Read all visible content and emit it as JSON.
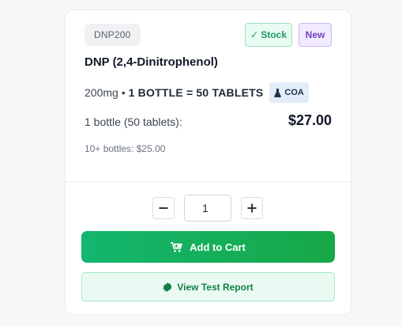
{
  "product": {
    "sku": "DNP200",
    "stock_badge": "✓ Stock",
    "new_badge": "New",
    "title": "DNP (2,4-Dinitrophenol)",
    "dose": "200mg •",
    "bottle_info": "1 BOTTLE = 50 TABLETS",
    "coa_label": "COA",
    "price_label": "1 bottle (50 tablets):",
    "price": "$27.00",
    "bulk_price": "10+ bottles: $25.00"
  },
  "quantity": {
    "value": "1",
    "minus_symbol": "−",
    "plus_symbol": "+"
  },
  "actions": {
    "add_to_cart": "Add to Cart",
    "view_report": "View Test Report"
  },
  "colors": {
    "cart_button": "#13b66f",
    "stock_green": "#1c9a5d",
    "new_purple": "#6f3ec7",
    "coa_bg": "#e3edf9"
  },
  "icons": {
    "cart": "cart-icon",
    "flask": "flask-icon",
    "certificate": "certificate-icon"
  }
}
